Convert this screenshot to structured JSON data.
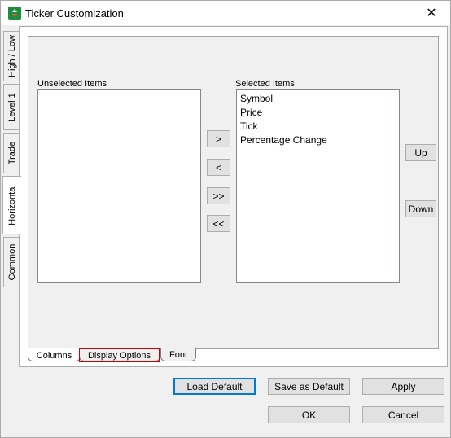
{
  "window": {
    "title": "Ticker Customization",
    "close_glyph": "✕"
  },
  "side_tabs": [
    {
      "label": "High / Low"
    },
    {
      "label": "Level 1"
    },
    {
      "label": "Trade"
    },
    {
      "label": "Horizontal",
      "active": true
    },
    {
      "label": "Common"
    }
  ],
  "columns_panel": {
    "unselected_label": "Unselected Items",
    "unselected_items": [],
    "selected_label": "Selected Items",
    "selected_items": [
      "Symbol",
      "Price",
      "Tick",
      "Percentage Change"
    ],
    "move_right": ">",
    "move_left": "<",
    "move_all_right": ">>",
    "move_all_left": "<<",
    "up": "Up",
    "down": "Down"
  },
  "bottom_tabs": [
    {
      "label": "Columns",
      "active": true
    },
    {
      "label": "Display Options",
      "focused": true
    },
    {
      "label": "Font"
    }
  ],
  "buttons": {
    "load_default": "Load Default",
    "save_default": "Save as Default",
    "apply": "Apply",
    "ok": "OK",
    "cancel": "Cancel"
  },
  "colors": {
    "accent": "#0078d7",
    "focus_red": "#cc0000",
    "icon_green": "#1e8e3e"
  }
}
